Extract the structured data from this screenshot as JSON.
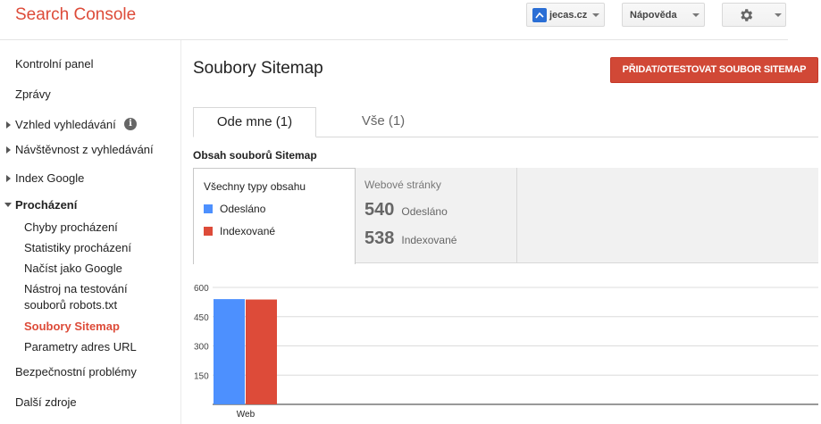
{
  "header": {
    "brand": "Search Console",
    "site_label": "jecas.cz",
    "help_label": "Nápověda"
  },
  "sidebar": {
    "items": [
      {
        "label": "Kontrolní panel"
      },
      {
        "label": "Zprávy"
      },
      {
        "label": "Vzhled vyhledávání"
      },
      {
        "label": "Návštěvnost z vyhledávání"
      },
      {
        "label": "Index Google"
      },
      {
        "label": "Procházení"
      },
      {
        "label": "Bezpečnostní problémy"
      },
      {
        "label": "Další zdroje"
      }
    ],
    "sub_items": [
      {
        "label": "Chyby procházení"
      },
      {
        "label": "Statistiky procházení"
      },
      {
        "label": "Načíst jako Google"
      },
      {
        "label": "Nástroj na testování souborů robots.txt"
      },
      {
        "label": "Soubory Sitemap"
      },
      {
        "label": "Parametry adres URL"
      }
    ]
  },
  "main": {
    "title": "Soubory Sitemap",
    "add_button": "PŘIDAT/OTESTOVAT SOUBOR SITEMAP",
    "tabs": [
      {
        "label": "Ode mne (1)"
      },
      {
        "label": "Vše (1)"
      }
    ],
    "section_title": "Obsah souborů Sitemap",
    "legend": {
      "title": "Všechny typy obsahu",
      "items": [
        {
          "label": "Odesláno",
          "color": "#4d90fe"
        },
        {
          "label": "Indexované",
          "color": "#dd4b39"
        }
      ]
    },
    "web_card": {
      "title": "Webové stránky",
      "rows": [
        {
          "value": "540",
          "label": "Odesláno"
        },
        {
          "value": "538",
          "label": "Indexované"
        }
      ]
    }
  },
  "chart_data": {
    "type": "bar",
    "categories": [
      "Web"
    ],
    "series": [
      {
        "name": "Odesláno",
        "values": [
          540
        ],
        "color": "#4d90fe"
      },
      {
        "name": "Indexované",
        "values": [
          538
        ],
        "color": "#dd4b39"
      }
    ],
    "yticks": [
      150,
      300,
      450,
      600
    ],
    "ylim": [
      0,
      600
    ],
    "grid": true
  }
}
